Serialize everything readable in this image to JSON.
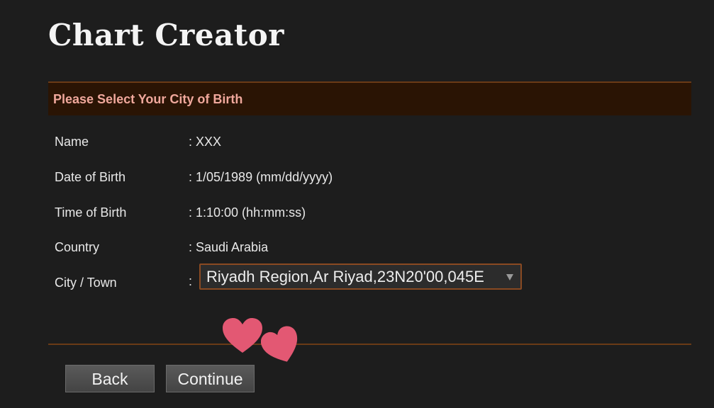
{
  "page": {
    "title": "Chart Creator"
  },
  "section": {
    "header": "Please Select Your City of Birth"
  },
  "fields": [
    {
      "label": "Name",
      "value": ": XXX"
    },
    {
      "label": "Date of Birth",
      "value": ": 1/05/1989 (mm/dd/yyyy)"
    },
    {
      "label": "Time of Birth",
      "value": ": 1:10:00 (hh:mm:ss)"
    },
    {
      "label": "Country",
      "value": ": Saudi Arabia"
    }
  ],
  "city": {
    "label": "City / Town",
    "separator": ":",
    "selected": "Riyadh Region,Ar Riyad,23N20'00,045E"
  },
  "buttons": {
    "back": "Back",
    "continue": "Continue"
  },
  "colors": {
    "background": "#1d1d1d",
    "header_bg": "#2a1404",
    "header_text": "#f0a89c",
    "accent_border": "#6a3a16",
    "heart": "#e35873"
  },
  "icons": {
    "stickers": "heart-icon",
    "dropdown": "chevron-down-icon"
  }
}
